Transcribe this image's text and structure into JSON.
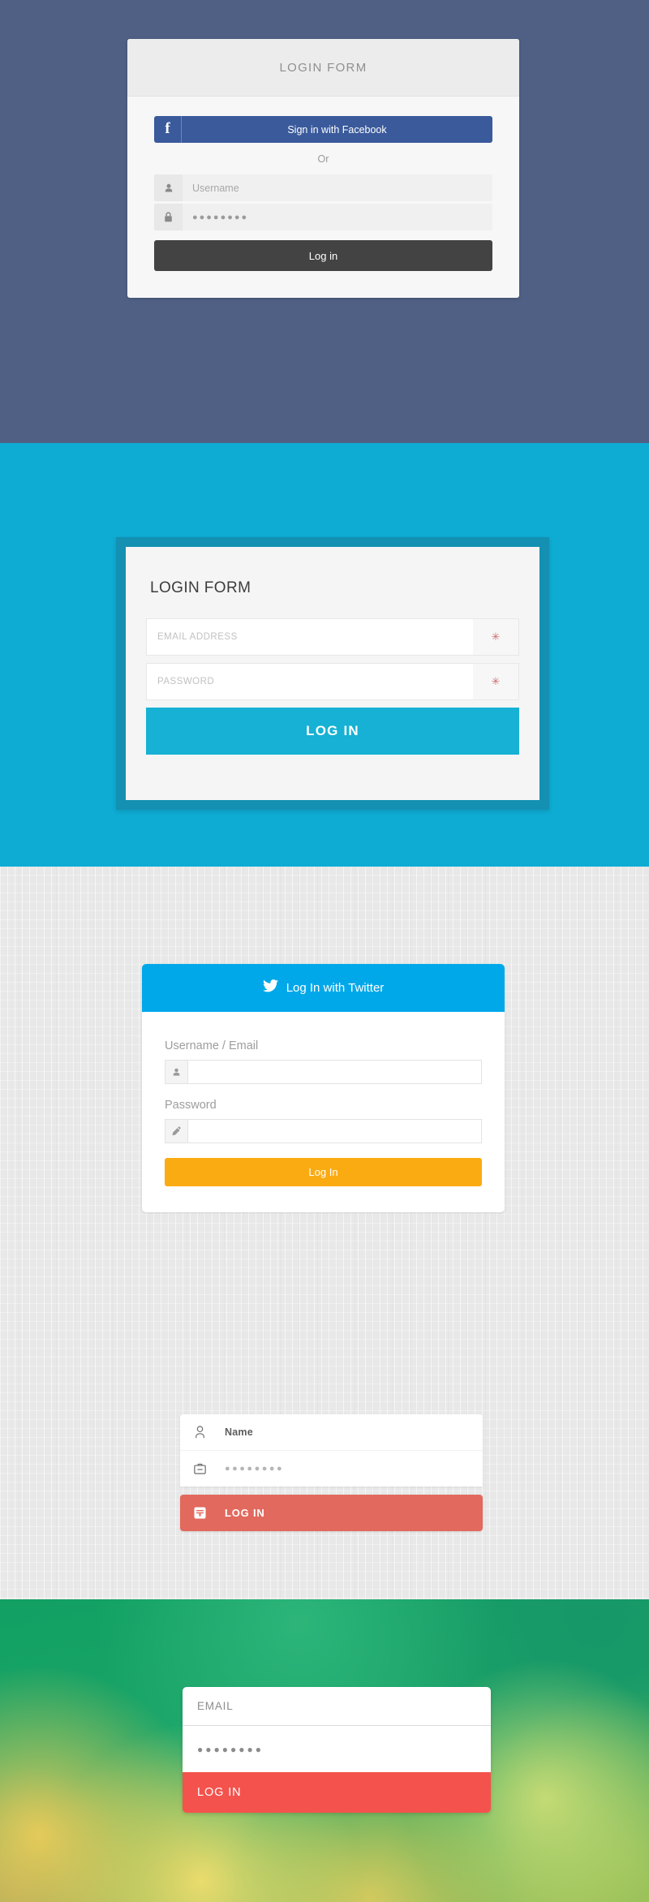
{
  "form_facebook": {
    "header_title": "LOGIN FORM",
    "facebook_icon": "facebook-f-icon",
    "facebook_label": "Sign in with Facebook",
    "or_text": "Or",
    "username_icon": "user-icon",
    "username_placeholder": "Username",
    "password_icon": "lock-icon",
    "password_value": "●●●●●●●●",
    "submit_label": "Log in",
    "colors": {
      "background": "#4f6084",
      "facebook_blue": "#3a5a9b",
      "submit_dark": "#434343",
      "card": "#f7f7f7"
    }
  },
  "form_flat_cyan": {
    "title": "LOGIN FORM",
    "email_placeholder": "EMAIL ADDRESS",
    "email_required_mark": "✳",
    "password_placeholder": "PASSWORD",
    "password_required_mark": "✳",
    "submit_label": "LOG IN",
    "colors": {
      "background": "#0eacd3",
      "frame": "#1390b2",
      "card": "#f5f5f5",
      "button": "#16b1d4",
      "required": "#d16a6a"
    }
  },
  "form_twitter": {
    "twitter_icon": "twitter-bird-icon",
    "twitter_label": "Log In with Twitter",
    "username_label": "Username / Email",
    "username_icon": "user-icon",
    "username_value": "",
    "password_label": "Password",
    "password_icon": "pencil-icon",
    "password_value": "",
    "submit_label": "Log In",
    "colors": {
      "background": "#e8e8e8",
      "header": "#00a8ea",
      "button": "#fbab12",
      "card": "#ffffff"
    }
  },
  "form_minimal_red": {
    "name_icon": "user-outline-icon",
    "name_value": "Name",
    "password_icon": "briefcase-icon",
    "password_value": "●●●●●●●●",
    "submit_icon": "chat-enter-icon",
    "submit_label": "LOG IN",
    "colors": {
      "card": "#ffffff",
      "button": "#e2695e"
    }
  },
  "form_bokeh": {
    "email_placeholder": "EMAIL",
    "password_value": "●●●●●●●●",
    "submit_label": "LOG IN",
    "colors": {
      "background": "#18a265",
      "card": "#ffffff",
      "button": "#f4524d"
    }
  }
}
